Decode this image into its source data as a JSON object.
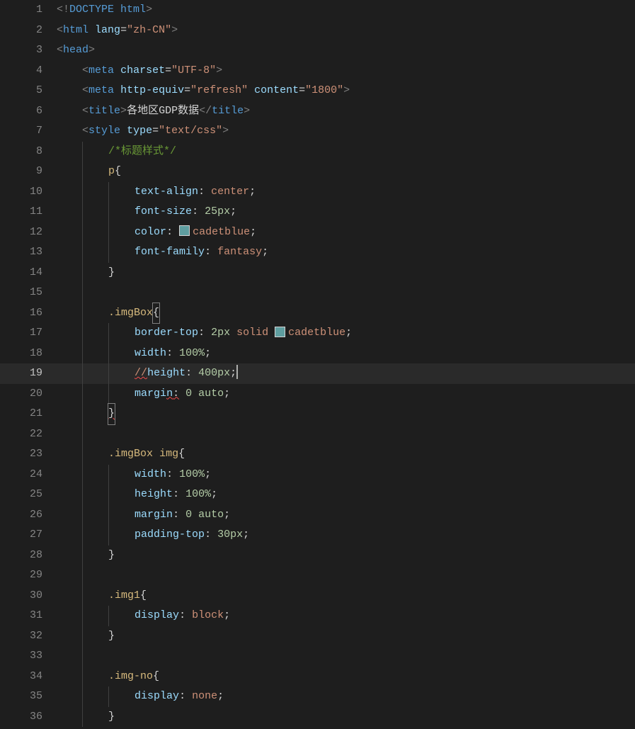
{
  "lines": {
    "1": {
      "num": "1"
    },
    "2": {
      "num": "2"
    },
    "3": {
      "num": "3"
    },
    "4": {
      "num": "4"
    },
    "5": {
      "num": "5"
    },
    "6": {
      "num": "6",
      "title_text": "各地区GDP数据"
    },
    "7": {
      "num": "7"
    },
    "8": {
      "num": "8",
      "comment": "/*标题样式*/"
    },
    "9": {
      "num": "9"
    },
    "10": {
      "num": "10"
    },
    "11": {
      "num": "11"
    },
    "12": {
      "num": "12"
    },
    "13": {
      "num": "13"
    },
    "14": {
      "num": "14"
    },
    "15": {
      "num": "15"
    },
    "16": {
      "num": "16"
    },
    "17": {
      "num": "17"
    },
    "18": {
      "num": "18"
    },
    "19": {
      "num": "19"
    },
    "20": {
      "num": "20"
    },
    "21": {
      "num": "21"
    },
    "22": {
      "num": "22"
    },
    "23": {
      "num": "23"
    },
    "24": {
      "num": "24"
    },
    "25": {
      "num": "25"
    },
    "26": {
      "num": "26"
    },
    "27": {
      "num": "27"
    },
    "28": {
      "num": "28"
    },
    "29": {
      "num": "29"
    },
    "30": {
      "num": "30"
    },
    "31": {
      "num": "31"
    },
    "32": {
      "num": "32"
    },
    "33": {
      "num": "33"
    },
    "34": {
      "num": "34"
    },
    "35": {
      "num": "35"
    },
    "36": {
      "num": "36"
    }
  },
  "tokens": {
    "doctype": "DOCTYPE",
    "html_kw": "html",
    "lang": "lang",
    "zhcn": "\"zh-CN\"",
    "head": "head",
    "meta": "meta",
    "charset": "charset",
    "utf8": "\"UTF-8\"",
    "httpequiv": "http-equiv",
    "refresh": "\"refresh\"",
    "content": "content",
    "v1800": "\"1800\"",
    "title": "title",
    "style": "style",
    "type": "type",
    "textcss": "\"text/css\"",
    "p": "p",
    "textalign": "text-align",
    "center": "center",
    "fontsize": "font-size",
    "v25px": "25px",
    "color": "color",
    "cadetblue": "cadetblue",
    "fontfamily": "font-family",
    "fantasy": "fantasy",
    "imgBox": ".imgBox",
    "img": "img",
    "bordertop": "border-top",
    "v2px": "2px",
    "solid": "solid",
    "width": "width",
    "pct100": "100%",
    "height": "height",
    "v400px": "400px",
    "margin": "margin",
    "v0": "0",
    "auto": "auto",
    "paddingtop": "padding-top",
    "v30px": "30px",
    "img1": ".img1",
    "display": "display",
    "block": "block",
    "imgno": ".img-no",
    "none": "none"
  }
}
